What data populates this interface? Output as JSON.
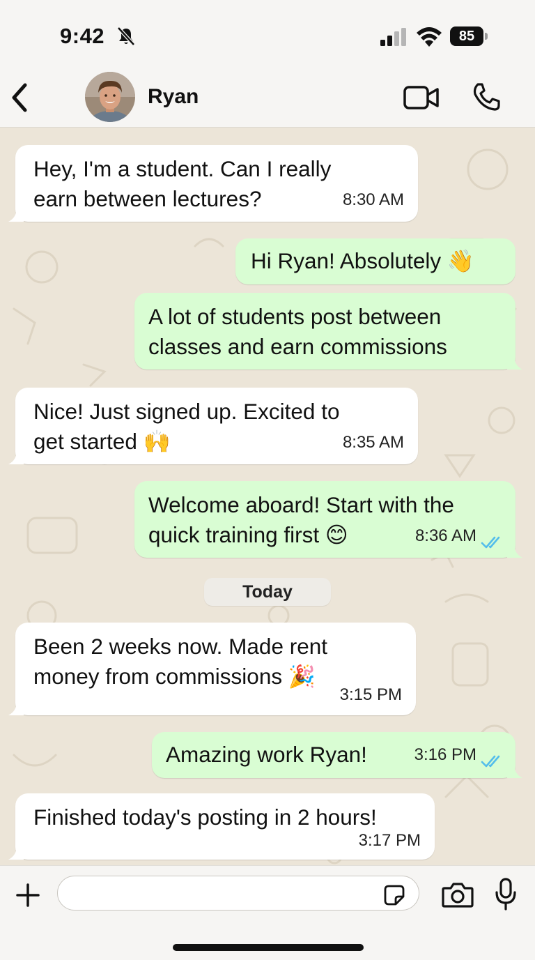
{
  "status_bar": {
    "time": "9:42",
    "battery": "85",
    "icons": [
      "bell-off-icon",
      "signal-icon",
      "wifi-icon",
      "battery-icon"
    ]
  },
  "header": {
    "contact_name": "Ryan",
    "icons": [
      "chevron-left-icon",
      "video-icon",
      "phone-icon"
    ]
  },
  "date_separator": "Today",
  "messages": [
    {
      "direction": "in",
      "text": "Hey, I'm a student. Can I really\nearn between lectures?",
      "time": "8:30 AM"
    },
    {
      "direction": "out",
      "text": "Hi Ryan! Absolutely 👋",
      "time": ""
    },
    {
      "direction": "out",
      "text": "A lot of students post between\nclasses and earn commissions",
      "time": ""
    },
    {
      "direction": "in",
      "text": "Nice! Just signed up. Excited to\nget started 🙌",
      "time": "8:35 AM"
    },
    {
      "direction": "out",
      "text": "Welcome aboard! Start with the\nquick training first 😊",
      "time": "8:36 AM",
      "read": true
    },
    {
      "direction": "in",
      "text": "Been 2 weeks now. Made rent\nmoney from commissions 🎉",
      "time": "3:15 PM"
    },
    {
      "direction": "out",
      "text": "Amazing work Ryan!",
      "time": "3:16 PM",
      "read": true
    },
    {
      "direction": "in",
      "text": "Finished today's posting in 2 hours!",
      "time": "3:17 PM"
    }
  ],
  "input_bar": {
    "placeholder": "",
    "icons": [
      "plus-icon",
      "sticker-icon",
      "camera-icon",
      "mic-icon"
    ]
  },
  "colors": {
    "outgoing_bubble": "#d9fdd3",
    "incoming_bubble": "#ffffff",
    "wallpaper": "#ece5d8",
    "read_ticks": "#53bdeb"
  }
}
